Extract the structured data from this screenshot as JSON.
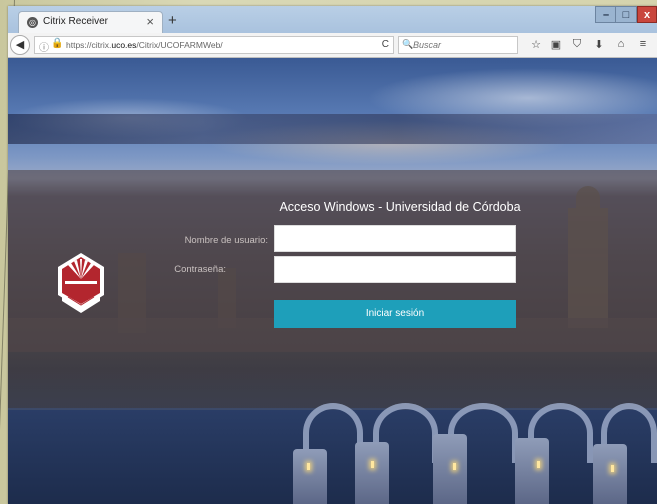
{
  "browser": {
    "tab": {
      "title": "Citrix Receiver",
      "close": "×",
      "favicon": "citrix-favicon"
    },
    "new_tab": "+",
    "window_controls": {
      "minimize": "–",
      "maximize": "□",
      "close": "x"
    },
    "toolbar": {
      "back": "◀",
      "url_prefix": "https://citrix.",
      "url_domain": "uco.es",
      "url_suffix": "/Citrix/UCOFARMWeb/",
      "reload": "C",
      "search_placeholder": "Buscar",
      "icons": [
        "star-icon",
        "clipboard-icon",
        "pocket-icon",
        "download-icon",
        "home-icon",
        "menu-icon"
      ]
    }
  },
  "login": {
    "title": "Acceso Windows - Universidad de Córdoba",
    "username_label": "Nombre de usuario:",
    "password_label": "Contraseña:",
    "username_value": "",
    "password_value": "",
    "submit_label": "Iniciar sesión"
  },
  "colors": {
    "accent_button": "#1e9fba",
    "overlay": "rgba(80,70,72,0.62)",
    "logo_red": "#b3262e"
  }
}
